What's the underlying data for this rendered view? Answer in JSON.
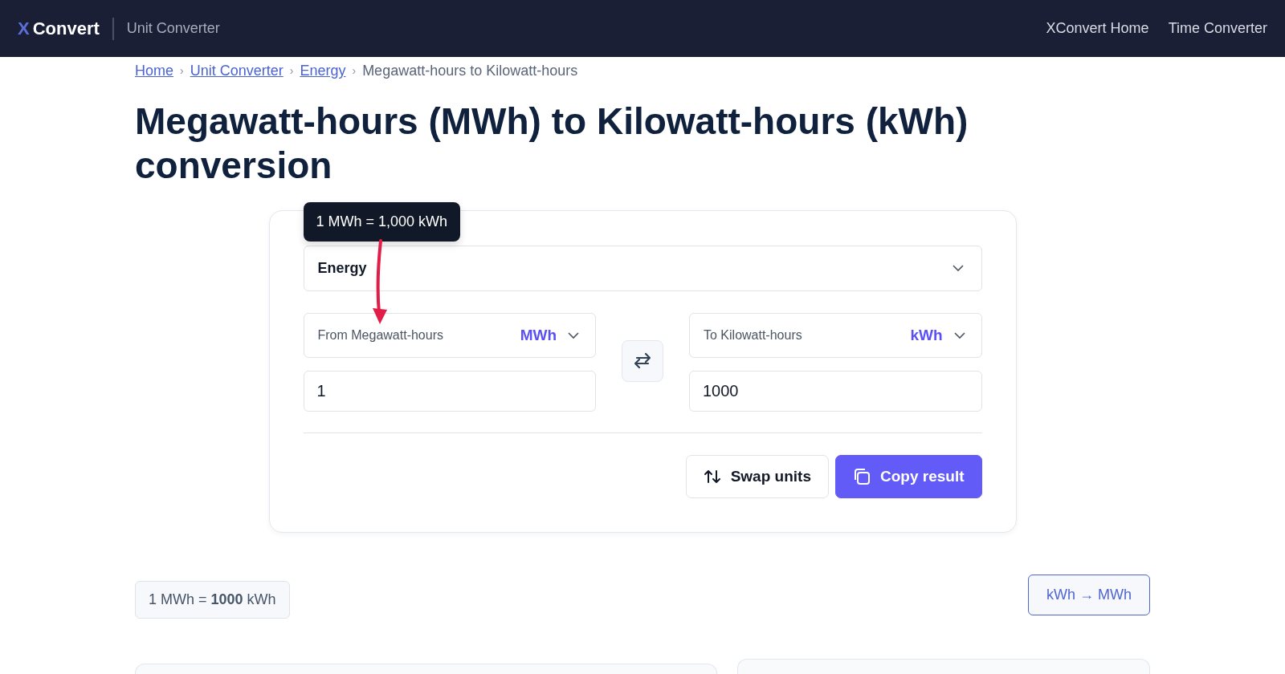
{
  "navbar": {
    "brand_mark": "X",
    "brand": "Convert",
    "section": "Unit Converter",
    "links": [
      "XConvert Home",
      "Time Converter"
    ]
  },
  "breadcrumb_separator": "›",
  "breadcrumb": [
    {
      "label": "Home",
      "link": true
    },
    {
      "label": "Unit Converter",
      "link": true
    },
    {
      "label": "Energy",
      "link": true
    },
    {
      "label": "Megawatt-hours to Kilowatt-hours",
      "link": false
    }
  ],
  "title": "Megawatt-hours (MWh) to Kilowatt-hours (kWh) conversion",
  "converter": {
    "tooltip": "1 MWh = 1,000 kWh",
    "category": "Energy",
    "from": {
      "label": "From Megawatt-hours",
      "unit": "MWh",
      "value": "1"
    },
    "to": {
      "label": "To Kilowatt-hours",
      "unit": "kWh",
      "value": "1000"
    },
    "buttons": [
      {
        "kind": "outline",
        "label": "Swap units"
      },
      {
        "kind": "primary",
        "label": "Copy result"
      }
    ]
  },
  "result_chip": "1 MWh = **1000** kWh",
  "reverse_link": "kWh → MWh"
}
